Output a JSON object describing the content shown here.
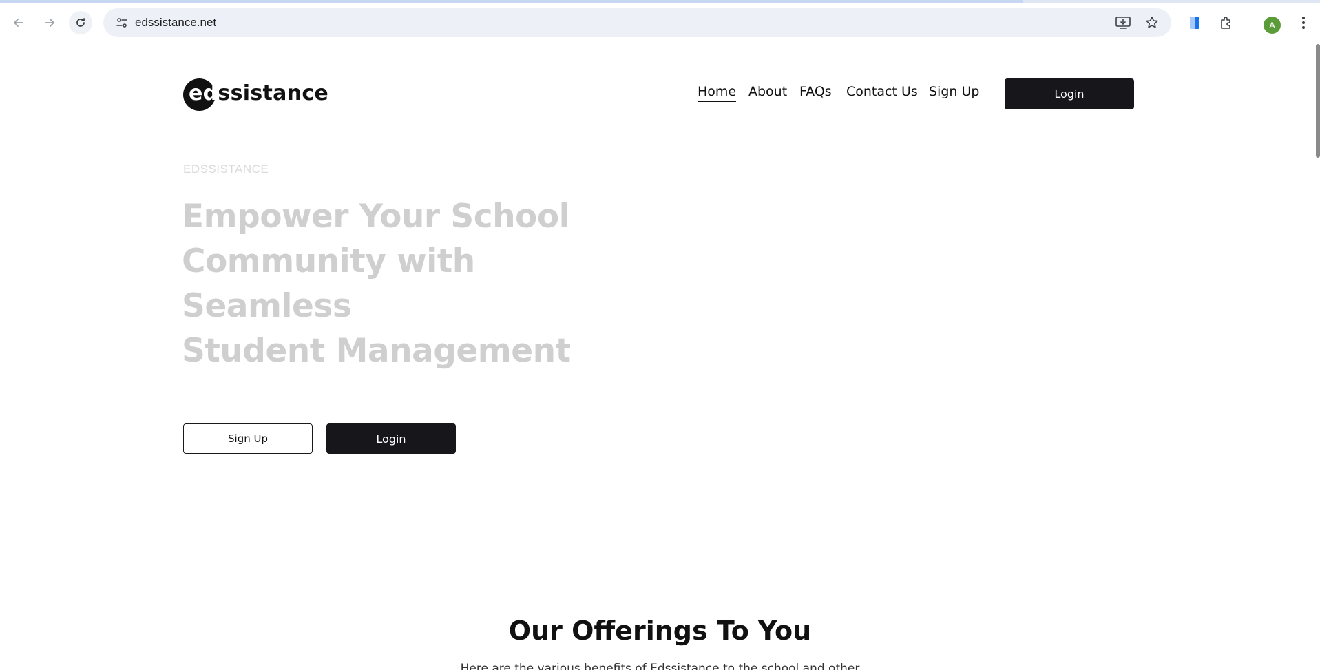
{
  "browser": {
    "url": "edssistance.net",
    "avatar_initial": "A",
    "icons": [
      "back-icon",
      "forward-icon",
      "reload-icon",
      "site-info-icon",
      "install-app-icon",
      "bookmark-star-icon",
      "reading-mode-icon",
      "extensions-icon",
      "more-menu-icon"
    ]
  },
  "header": {
    "logo_ed": "ed",
    "logo_rest": "ssistance",
    "nav": [
      {
        "label": "Home"
      },
      {
        "label": "About"
      },
      {
        "label": "FAQs"
      },
      {
        "label": "Contact Us"
      },
      {
        "label": "Sign Up"
      }
    ],
    "login_label": "Login"
  },
  "hero": {
    "eyebrow": "EDSSISTANCE",
    "title_line1": "Empower Your School",
    "title_line2": "Community with Seamless",
    "title_line3": "Student Management",
    "signup_label": "Sign Up",
    "login_label": "Login"
  },
  "offerings": {
    "title": "Our Offerings To You",
    "subtitle": "Here are the various benefits of Edssistance to the school and other"
  },
  "colors": {
    "dark_button": "#17161a",
    "hero_text": "#cfcfcf",
    "eyebrow_text": "#dadada",
    "avatar": "#5b9b3a"
  }
}
